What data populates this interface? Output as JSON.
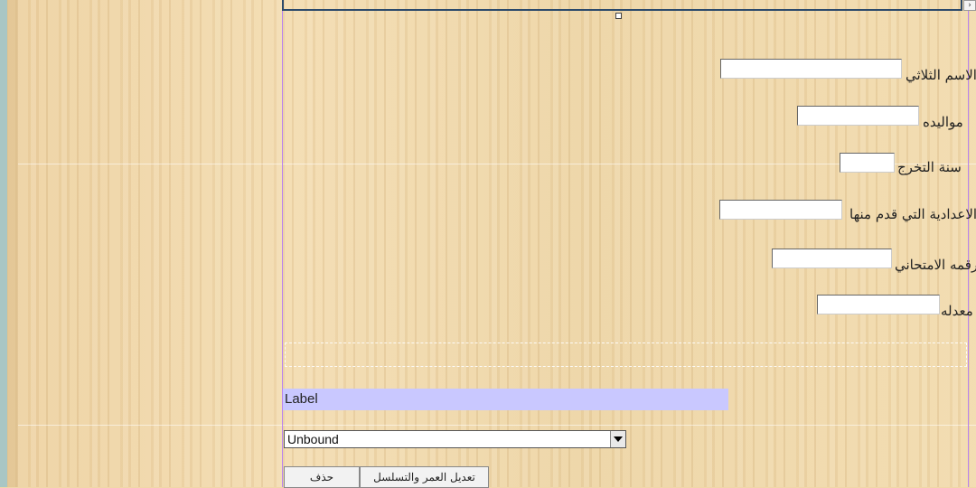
{
  "form": {
    "fields": [
      {
        "label": "الاسم الثلاثي",
        "value": ""
      },
      {
        "label": "مواليده",
        "value": ""
      },
      {
        "label": "سنة التخرج",
        "value": ""
      },
      {
        "label": "الاعدادية التي قدم منها",
        "value": ""
      },
      {
        "label": "رقمه الامتحاني",
        "value": ""
      },
      {
        "label": "معدله",
        "value": ""
      }
    ],
    "label_control": "Label",
    "combo_value": "Unbound",
    "buttons": {
      "delete": "حذف",
      "edit_age": "تعديل العمر والتسلسل"
    }
  },
  "window": {
    "scroll_arrow": "›"
  },
  "colors": {
    "label_background": "#c9c8ff",
    "selection_border": "#b983f0",
    "header_border": "#2c4a6b"
  }
}
